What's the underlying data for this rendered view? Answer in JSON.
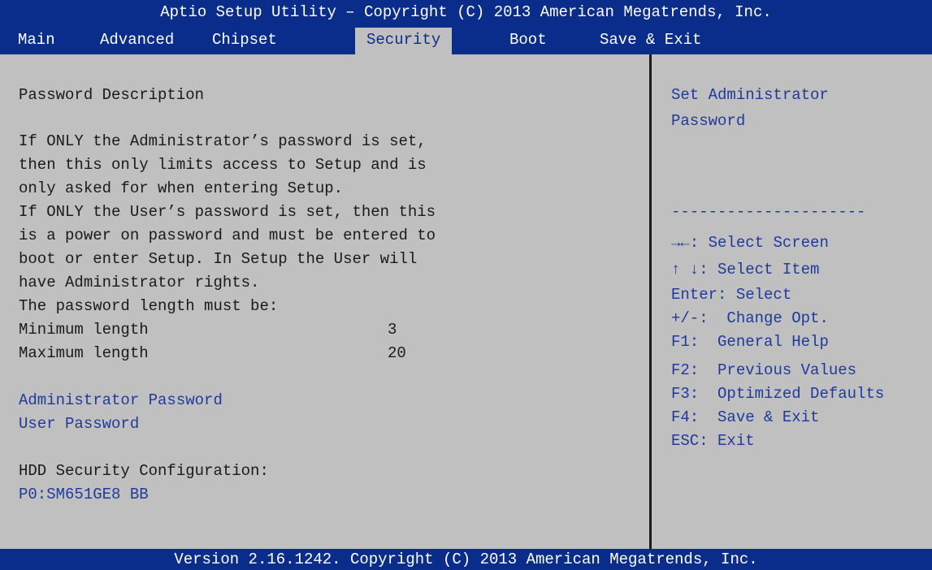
{
  "title": "Aptio Setup Utility – Copyright (C) 2013 American Megatrends, Inc.",
  "menu": {
    "tabs": [
      {
        "label": "Main"
      },
      {
        "label": "Advanced"
      },
      {
        "label": "Chipset"
      },
      {
        "label": "Security",
        "active": true
      },
      {
        "label": "Boot"
      },
      {
        "label": "Save & Exit"
      }
    ]
  },
  "main": {
    "heading": "Password Description",
    "description": [
      "If ONLY the Administrator’s password is set,",
      "then this only limits access to Setup and is",
      "only asked for when entering Setup.",
      "If ONLY the User’s password is set, then this",
      "is a power on password and must be entered to",
      "boot or enter Setup. In Setup the User will",
      "have Administrator rights.",
      "The password length must be:"
    ],
    "min_length": {
      "label": "Minimum length",
      "value": "3"
    },
    "max_length": {
      "label": "Maximum length",
      "value": "20"
    },
    "admin_password": "Administrator Password",
    "user_password": "User Password",
    "hdd_heading": "HDD Security Configuration:",
    "hdd_device": "P0:SM651GE8 BB"
  },
  "help": {
    "text_line1": "Set Administrator",
    "text_line2": "Password",
    "separator": "---------------------",
    "keys": [
      {
        "key": "→←:",
        "action": "Select Screen"
      },
      {
        "key": "↑ ↓:",
        "action": "Select Item"
      },
      {
        "key": "Enter:",
        "action": "Select"
      },
      {
        "key": "+/-:",
        "action": "Change Opt."
      },
      {
        "key": "F1:",
        "action": "General Help"
      },
      {
        "key": "F2:",
        "action": "Previous Values"
      },
      {
        "key": "F3:",
        "action": "Optimized Defaults"
      },
      {
        "key": "F4:",
        "action": "Save & Exit"
      },
      {
        "key": "ESC:",
        "action": "Exit"
      }
    ]
  },
  "footer": "Version 2.16.1242. Copyright (C) 2013 American Megatrends, Inc.",
  "colors": {
    "bar_blue": "#0a2d8c",
    "panel_gray": "#c0c0c0",
    "link_blue": "#1f3a9c"
  }
}
